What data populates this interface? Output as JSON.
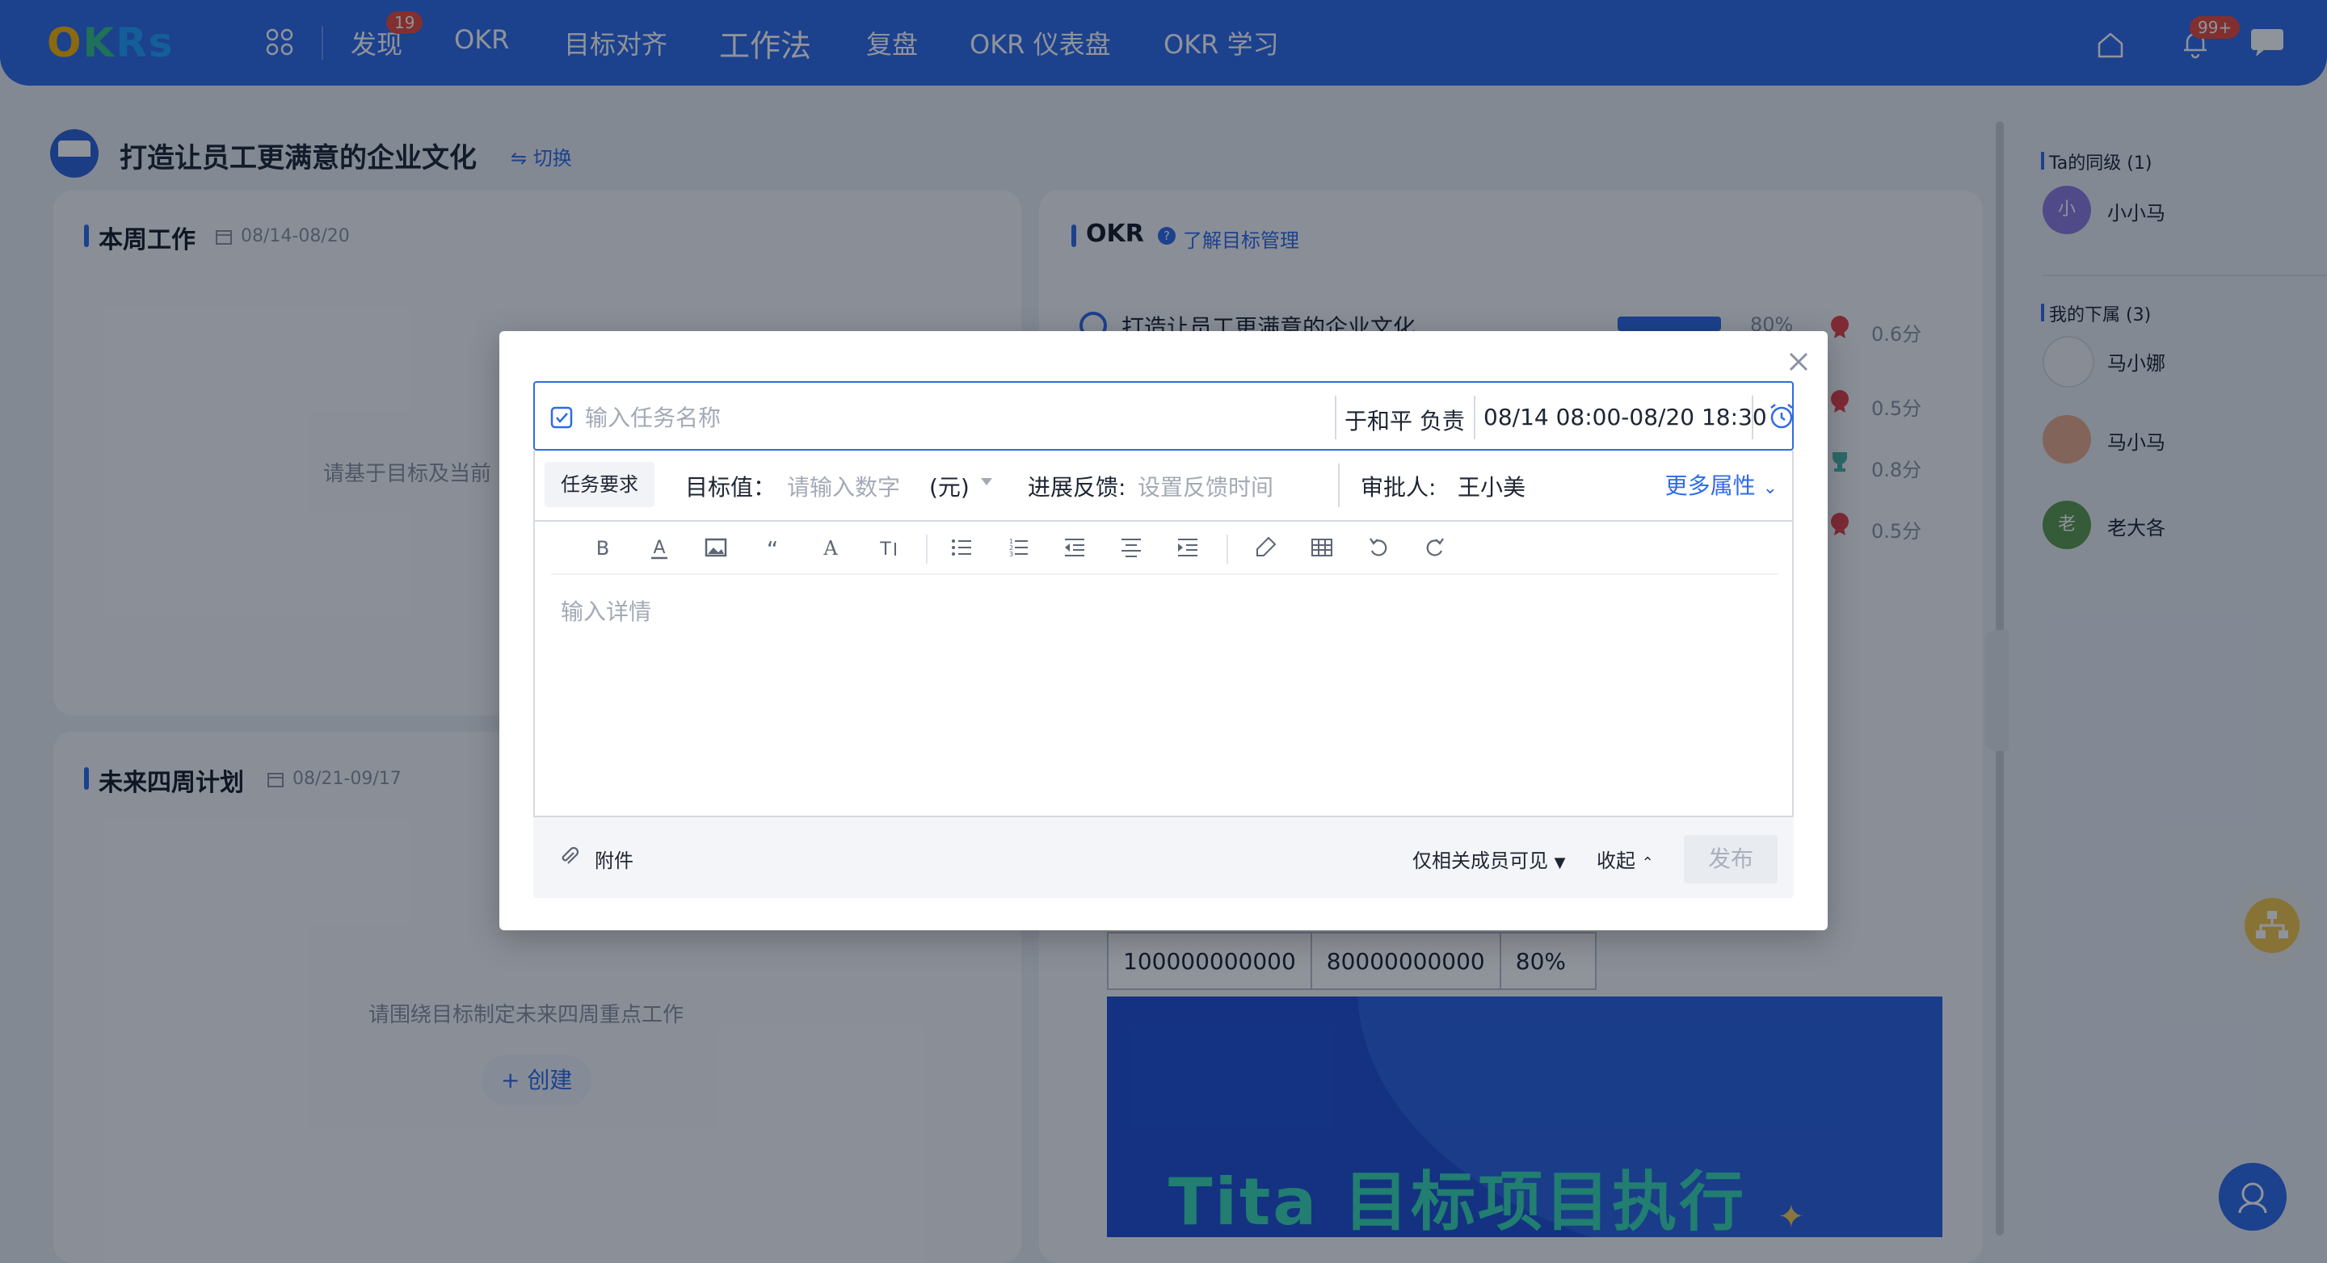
{
  "nav": {
    "logo": "OKRs",
    "items": [
      {
        "label": "发现",
        "badge": "19"
      },
      {
        "label": "OKR"
      },
      {
        "label": "目标对齐"
      },
      {
        "label": "工作法"
      },
      {
        "label": "复盘"
      },
      {
        "label": "OKR 仪表盘"
      },
      {
        "label": "OKR 学习"
      }
    ],
    "notification_badge": "99+"
  },
  "page": {
    "title": "打造让员工更满意的企业文化",
    "switch_label": "⇋ 切换"
  },
  "this_week": {
    "title": "本周工作",
    "date": "08/14-08/20",
    "empty_text": "请基于目标及当前"
  },
  "next_four_weeks": {
    "title": "未来四周计划",
    "date": "08/21-09/17",
    "empty_text": "请围绕目标制定未来四周重点工作",
    "create_label": "+ 创建"
  },
  "okr_card": {
    "title": "OKR",
    "help_link": "了解目标管理",
    "objective": "打造让员工更满意的企业文化",
    "progress_label": "80%",
    "scores": [
      "0.6分",
      "0.5分",
      "0.8分",
      "0.5分"
    ]
  },
  "value_table": {
    "cells": [
      "100000000000",
      "80000000000",
      "80%"
    ]
  },
  "banner": {
    "text": "Tita 目标项目执行"
  },
  "right_panel": {
    "peers_title": "Ta的同级 (1)",
    "peers": [
      {
        "initial": "小",
        "name": "小小马"
      }
    ],
    "reports_title": "我的下属 (3)",
    "reports": [
      {
        "initial": "",
        "name": "马小娜"
      },
      {
        "initial": "",
        "name": "马小马"
      },
      {
        "initial": "老",
        "name": "老大各"
      }
    ]
  },
  "modal": {
    "task_placeholder": "输入任务名称",
    "owner": "于和平 负责",
    "date_range": "08/14 08:00-08/20 18:30",
    "req_tag": "任务要求",
    "target_label": "目标值：",
    "target_placeholder": "请输入数字",
    "unit": "(元)",
    "feedback_label": "进展反馈:",
    "feedback_placeholder": "设置反馈时间",
    "approver_label": "审批人:",
    "approver": "王小美",
    "more_attrs": "更多属性",
    "editor_placeholder": "输入详情",
    "attach_label": "附件",
    "visibility": "仅相关成员可见",
    "fold": "收起",
    "publish": "发布"
  },
  "colors": {
    "primary": "#2f6ae8",
    "banner_text": "#37d9b3",
    "badge": "#e64b3c"
  }
}
